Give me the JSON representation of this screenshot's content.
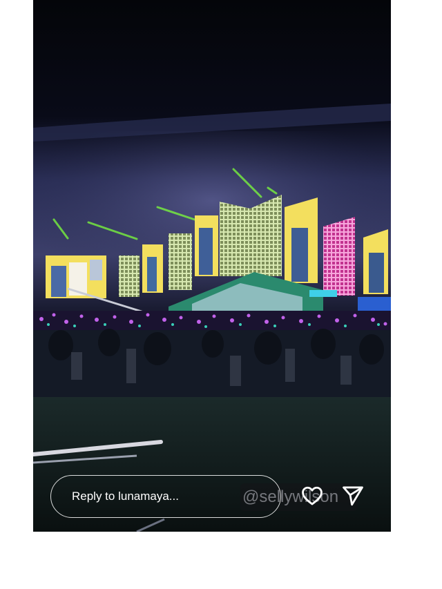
{
  "story": {
    "reply_placeholder": "Reply to lunamaya...",
    "watermark": "@sellywilson"
  },
  "icons": {
    "like": "heart-icon",
    "share": "send-icon"
  },
  "colors": {
    "background": "#07080f",
    "stage_screen_yellow": "#f3df5e",
    "stage_screen_pink": "#e83fa8",
    "laser_green": "#7dff3a",
    "lightstick_purple": "#b04dff"
  }
}
